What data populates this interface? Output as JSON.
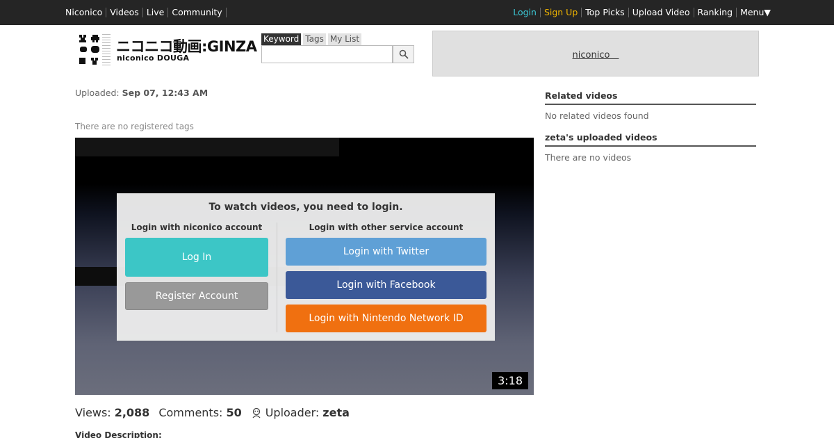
{
  "topbar": {
    "left": [
      "Niconico",
      "Videos",
      "Live",
      "Community"
    ],
    "login": "Login",
    "signup": "Sign Up",
    "right": [
      "Top Picks",
      "Upload Video",
      "Ranking"
    ],
    "menu": "Menu▼"
  },
  "logo": {
    "main": "ニコニコ動画:GINZA",
    "sub": "niconico DOUGA"
  },
  "search": {
    "tabs": [
      "Keyword",
      "Tags",
      "My List"
    ],
    "value": ""
  },
  "ad": {
    "link": "niconico　"
  },
  "video": {
    "uploaded_label": "Uploaded:",
    "uploaded_value": "Sep 07, 12:43 AM",
    "tags_note": "There are no registered tags",
    "duration": "3:18",
    "views_label": "Views:",
    "views": "2,088",
    "comments_label": "Comments:",
    "comments": "50",
    "uploader_label": "Uploader:",
    "uploader": "zeta",
    "description_label": "Video Description:"
  },
  "login_overlay": {
    "title": "To watch videos, you need to login.",
    "niconico_head": "Login with niconico account",
    "other_head": "Login with other service account",
    "login_btn": "Log In",
    "register_btn": "Register Account",
    "twitter_btn": "Login with Twitter",
    "facebook_btn": "Login with Facebook",
    "nintendo_btn": "Login with Nintendo Network ID"
  },
  "sidebar": {
    "related_head": "Related videos",
    "related_note": "No related videos found",
    "uploads_head": "zeta's uploaded videos",
    "uploads_note": "There are no videos"
  },
  "colors": {
    "topbar_bg": "#252525",
    "login_accent": "#3cc8d6",
    "signup_accent": "#f0b400",
    "twitter": "#5fa0d6",
    "facebook": "#3b5998",
    "nintendo": "#f07010"
  }
}
